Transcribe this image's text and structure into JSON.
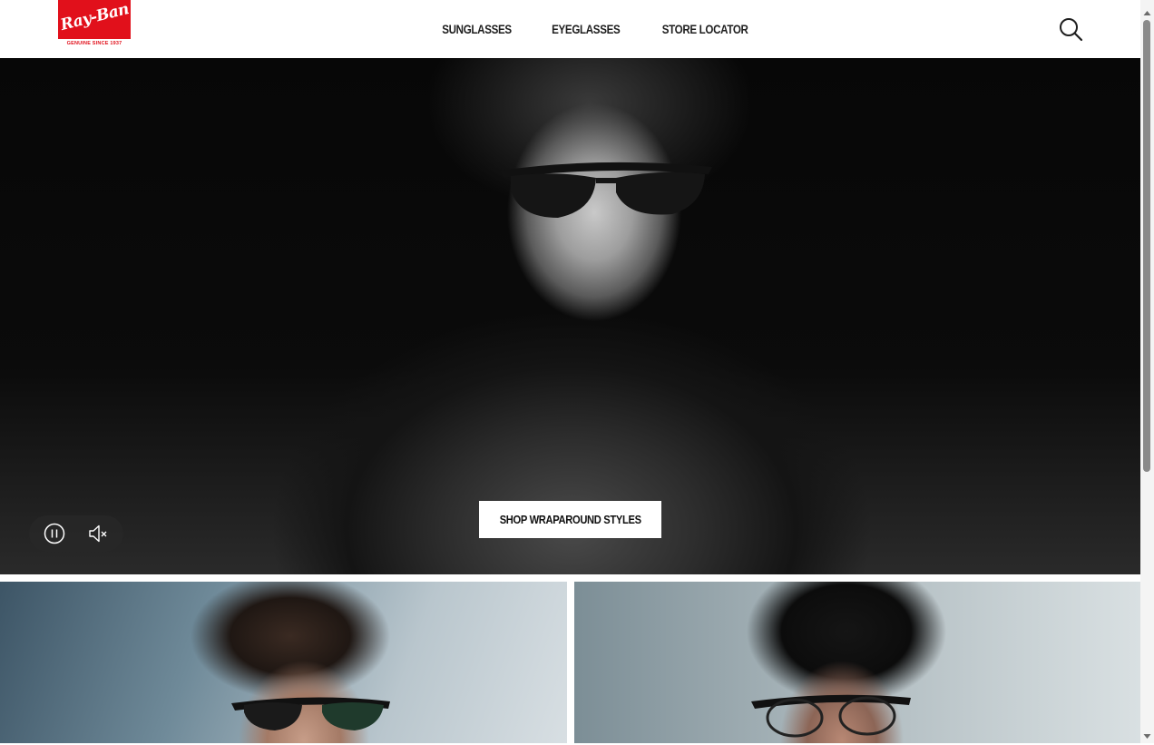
{
  "header": {
    "logo": {
      "wordmark": "Ray-Ban",
      "tagline": "GENUINE SINCE 1937",
      "brand_color": "#e1101b",
      "icon": "rayban-logo"
    },
    "nav": [
      {
        "label": "SUNGLASSES"
      },
      {
        "label": "EYEGLASSES"
      },
      {
        "label": "STORE LOCATOR"
      }
    ],
    "search_icon": "search-icon"
  },
  "hero": {
    "cta_label": "SHOP WRAPAROUND STYLES",
    "video_controls": {
      "pause_icon": "pause-icon",
      "mute_icon": "speaker-muted-icon"
    },
    "style": "black-and-white video"
  },
  "tiles": [
    {
      "name": "left-product-tile",
      "subject": "person wearing black and tortoise clubmaster-style sunglasses"
    },
    {
      "name": "right-product-tile",
      "subject": "person wearing black browline eyeglasses"
    }
  ],
  "colors": {
    "background": "#ffffff",
    "nav_text": "#1f1f1f",
    "cta_background": "#ffffff",
    "cta_text": "#111111"
  }
}
